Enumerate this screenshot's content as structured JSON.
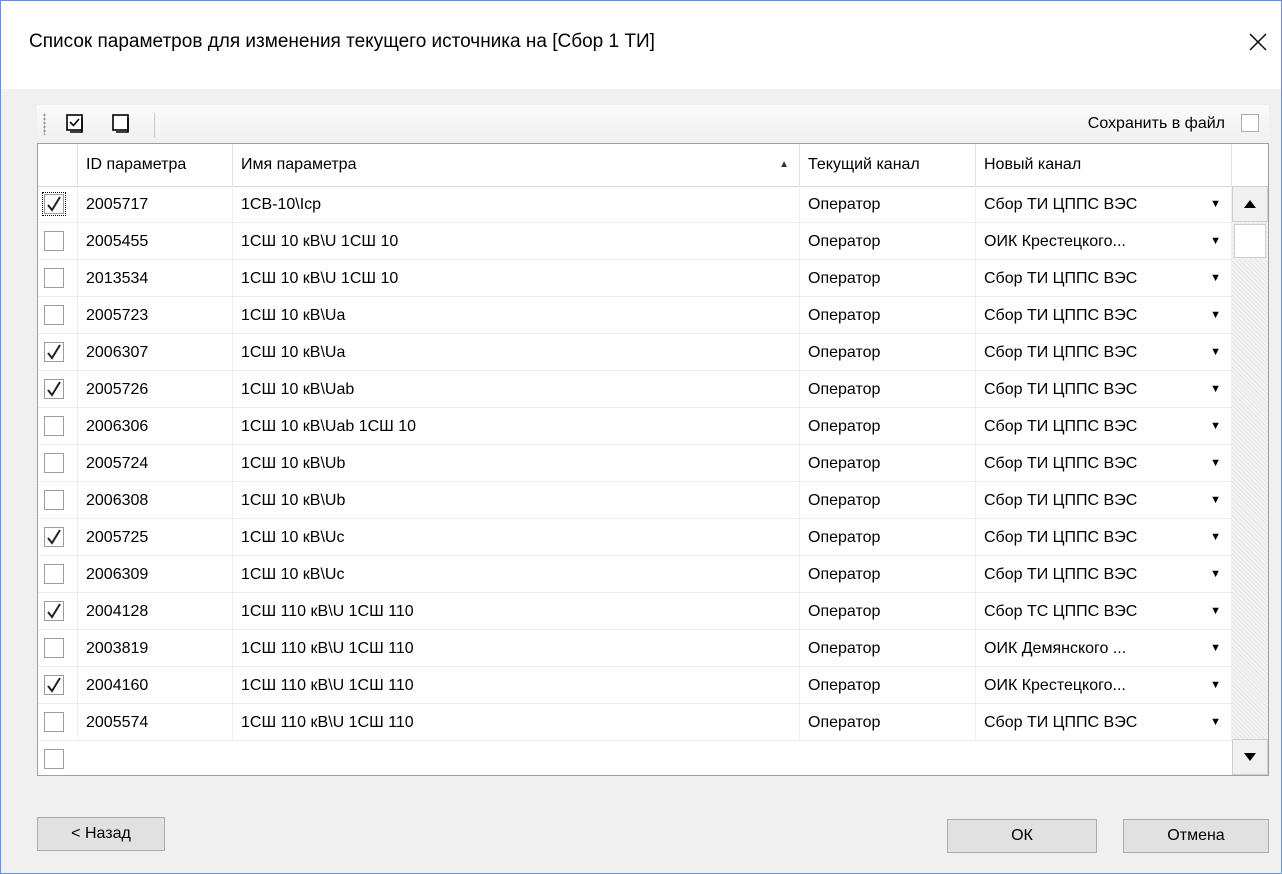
{
  "window": {
    "title": "Список параметров для изменения текущего источника на [Сбор 1 ТИ]"
  },
  "toolbar": {
    "check_all_icon": "check-all-icon",
    "uncheck_all_icon": "uncheck-all-icon",
    "save_to_file_label": "Сохранить в файл",
    "save_to_file_checked": false
  },
  "grid": {
    "columns": [
      "ID параметра",
      "Имя параметра",
      "Текущий канал",
      "Новый канал"
    ],
    "sorted_column": "Имя параметра",
    "sort_direction": "ascending",
    "rows": [
      {
        "checked": true,
        "id": "2005717",
        "name": "1СВ-10\\Iср",
        "current": "Оператор",
        "new": "Сбор ТИ ЦППС ВЭС"
      },
      {
        "checked": false,
        "id": "2005455",
        "name": "1СШ 10 кВ\\U 1СШ 10",
        "current": "Оператор",
        "new": "ОИК Крестецкого..."
      },
      {
        "checked": false,
        "id": "2013534",
        "name": "1СШ 10 кВ\\U 1СШ 10",
        "current": "Оператор",
        "new": "Сбор ТИ ЦППС ВЭС"
      },
      {
        "checked": false,
        "id": "2005723",
        "name": "1СШ 10 кВ\\Ua",
        "current": "Оператор",
        "new": "Сбор ТИ ЦППС ВЭС"
      },
      {
        "checked": true,
        "id": "2006307",
        "name": "1СШ 10 кВ\\Ua",
        "current": "Оператор",
        "new": "Сбор ТИ ЦППС ВЭС"
      },
      {
        "checked": true,
        "id": "2005726",
        "name": "1СШ 10 кВ\\Uab",
        "current": "Оператор",
        "new": "Сбор ТИ ЦППС ВЭС"
      },
      {
        "checked": false,
        "id": "2006306",
        "name": "1СШ 10 кВ\\Uab 1СШ 10",
        "current": "Оператор",
        "new": "Сбор ТИ ЦППС ВЭС"
      },
      {
        "checked": false,
        "id": "2005724",
        "name": "1СШ 10 кВ\\Ub",
        "current": "Оператор",
        "new": "Сбор ТИ ЦППС ВЭС"
      },
      {
        "checked": false,
        "id": "2006308",
        "name": "1СШ 10 кВ\\Ub",
        "current": "Оператор",
        "new": "Сбор ТИ ЦППС ВЭС"
      },
      {
        "checked": true,
        "id": "2005725",
        "name": "1СШ 10 кВ\\Uc",
        "current": "Оператор",
        "new": "Сбор ТИ ЦППС ВЭС"
      },
      {
        "checked": false,
        "id": "2006309",
        "name": "1СШ 10 кВ\\Uc",
        "current": "Оператор",
        "new": "Сбор ТИ ЦППС ВЭС"
      },
      {
        "checked": true,
        "id": "2004128",
        "name": "1СШ 110 кВ\\U 1СШ 110",
        "current": "Оператор",
        "new": "Сбор ТС ЦППС ВЭС"
      },
      {
        "checked": false,
        "id": "2003819",
        "name": "1СШ 110 кВ\\U 1СШ 110",
        "current": "Оператор",
        "new": "ОИК Демянского ..."
      },
      {
        "checked": true,
        "id": "2004160",
        "name": "1СШ 110 кВ\\U 1СШ 110",
        "current": "Оператор",
        "new": "ОИК Крестецкого..."
      },
      {
        "checked": false,
        "id": "2005574",
        "name": "1СШ 110 кВ\\U 1СШ 110",
        "current": "Оператор",
        "new": "Сбор ТИ ЦППС ВЭС"
      }
    ]
  },
  "buttons": {
    "back": "< Назад",
    "ok": "ОК",
    "cancel": "Отмена"
  },
  "colors": {
    "window_border": "#6a8fd0",
    "client_bg": "#f0f0f0",
    "button_bg": "#e1e1e1"
  }
}
